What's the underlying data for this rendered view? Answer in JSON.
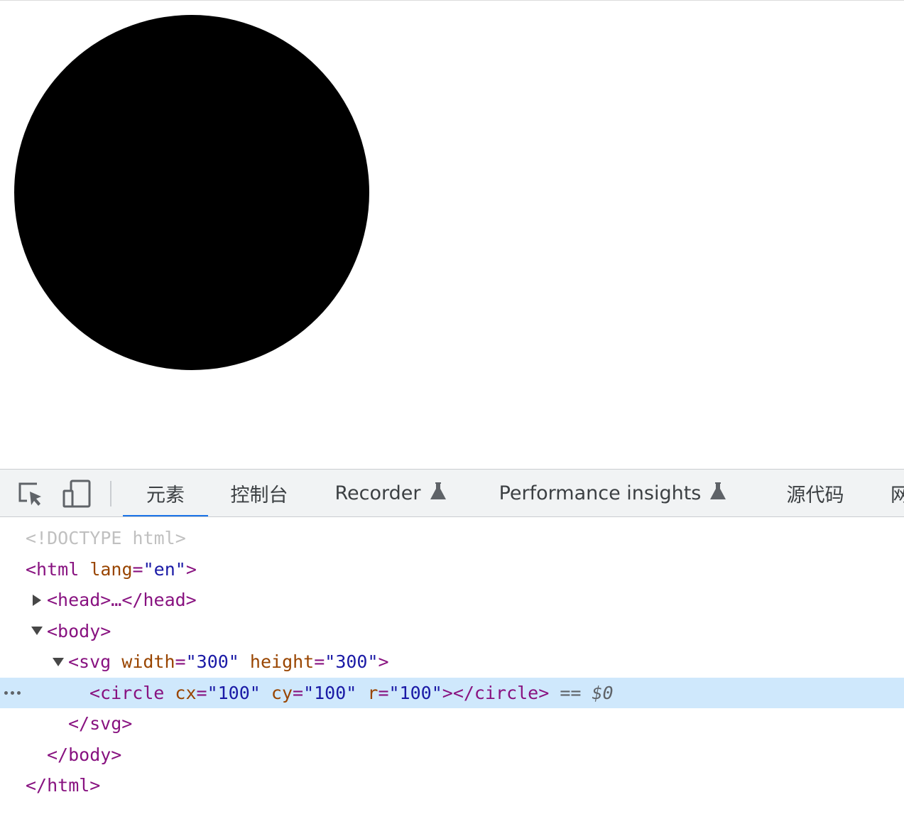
{
  "viewport": {
    "circle_color": "#000000"
  },
  "toolbar": {
    "icons": [
      "inspect-element-icon",
      "device-toolbar-icon"
    ],
    "tabs": [
      {
        "label": "元素",
        "active": true
      },
      {
        "label": "控制台"
      },
      {
        "label": "Recorder",
        "experimental": true
      },
      {
        "label": "Performance insights",
        "experimental": true
      },
      {
        "label": "源代码"
      },
      {
        "label": "网"
      }
    ],
    "active_color": "#1a73e8"
  },
  "tree": {
    "doctype": "<!DOCTYPE html>",
    "html_open": "<html",
    "lang_attr": " lang",
    "eq": "=",
    "lang_val": "\"en\"",
    "close_gt": ">",
    "head_collapsed": "<head>…</head>",
    "body_open": "<body>",
    "svg_open": "<svg",
    "svg_width_attr": " width",
    "svg_width_val": "\"300\"",
    "svg_height_attr": " height",
    "svg_height_val": "\"300\"",
    "circle_open": "<circle",
    "cx_attr": " cx",
    "cx_val": "\"100\"",
    "cy_attr": " cy",
    "cy_val": "\"100\"",
    "r_attr": " r",
    "r_val": "\"100\"",
    "circle_close": "></circle>",
    "selected_ref": " == $0",
    "svg_close": "</svg>",
    "body_close": "</body>",
    "html_close": "</html>"
  }
}
